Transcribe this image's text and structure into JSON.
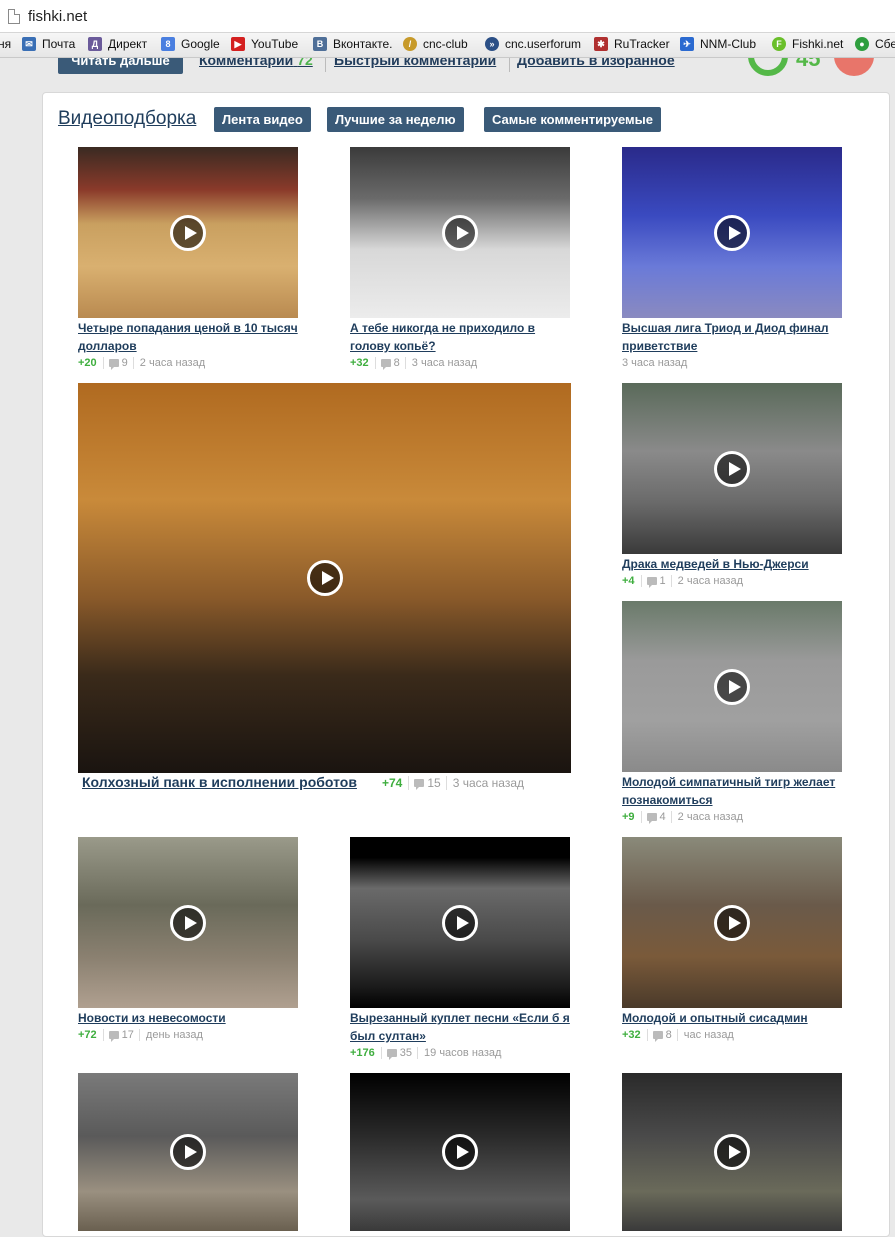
{
  "browser": {
    "url": "fishki.net",
    "bookmarks": [
      {
        "label": "ня",
        "icon": "none"
      },
      {
        "label": "Почта",
        "icon": "mail-icon",
        "color": "#3a6fb5"
      },
      {
        "label": "Директ",
        "icon": "direct-icon",
        "color": "#6a5a9a"
      },
      {
        "label": "Google",
        "icon": "google-icon",
        "color": "#4a7fe0"
      },
      {
        "label": "YouTube",
        "icon": "youtube-icon",
        "color": "#d42020"
      },
      {
        "label": "Вконтакте.",
        "icon": "vk-icon",
        "color": "#4f6f98"
      },
      {
        "label": "cnc-club",
        "icon": "cnc-club-icon",
        "color": "#c79a2a"
      },
      {
        "label": "cnc.userforum",
        "icon": "forum-icon",
        "color": "#2b4f86"
      },
      {
        "label": "RuTracker",
        "icon": "rutracker-icon",
        "color": "#b03030"
      },
      {
        "label": "NNM-Club",
        "icon": "nnm-club-icon",
        "color": "#2b6ad0"
      },
      {
        "label": "Fishki.net",
        "icon": "fishki-icon",
        "color": "#6abf2a"
      },
      {
        "label": "Сбе",
        "icon": "sber-icon",
        "color": "#2e9e3e"
      }
    ]
  },
  "top_strip": {
    "read_more": "Читать дальше",
    "comments_label": "Комментарии",
    "comments_count": "72",
    "quick_comment": "Быстрый комментарий",
    "add_favorite": "Добавить в избранное",
    "rating": "45"
  },
  "section": {
    "heading": "Видеоподборка",
    "tabs": [
      "Лента видео",
      "Лучшие за неделю",
      "Самые комментируемые"
    ]
  },
  "colors": {
    "accent": "#3a5a78",
    "link": "#1f3d5c",
    "plus": "#3fae3f"
  },
  "videos": [
    {
      "title": "Четыре попадания ценой в 10 тысяч долларов",
      "plus": "+20",
      "comments": "9",
      "time": "2 часа назад"
    },
    {
      "title": "А тебе никогда не приходило в голову копьё?",
      "plus": "+32",
      "comments": "8",
      "time": "3 часа назад"
    },
    {
      "title": "Высшая лига Триод и Диод финал приветствие",
      "plus": "",
      "comments": "",
      "time": "3 часа назад"
    },
    {
      "title": "Колхозный панк в исполнении роботов",
      "plus": "+74",
      "comments": "15",
      "time": "3 часа назад"
    },
    {
      "title": "Драка медведей в Нью-Джерси",
      "plus": "+4",
      "comments": "1",
      "time": "2 часа назад"
    },
    {
      "title": "Молодой симпатичный тигр желает познакомиться",
      "plus": "+9",
      "comments": "4",
      "time": "2 часа назад"
    },
    {
      "title": "Новости из невесомости",
      "plus": "+72",
      "comments": "17",
      "time": "день назад"
    },
    {
      "title": "Вырезанный куплет песни «Если б я был султан»",
      "plus": "+176",
      "comments": "35",
      "time": "19 часов назад"
    },
    {
      "title": "Молодой и опытный сисадмин",
      "plus": "+32",
      "comments": "8",
      "time": "час назад"
    },
    {
      "title": "",
      "plus": "",
      "comments": "",
      "time": ""
    },
    {
      "title": "",
      "plus": "",
      "comments": "",
      "time": ""
    },
    {
      "title": "",
      "plus": "",
      "comments": "",
      "time": ""
    }
  ]
}
